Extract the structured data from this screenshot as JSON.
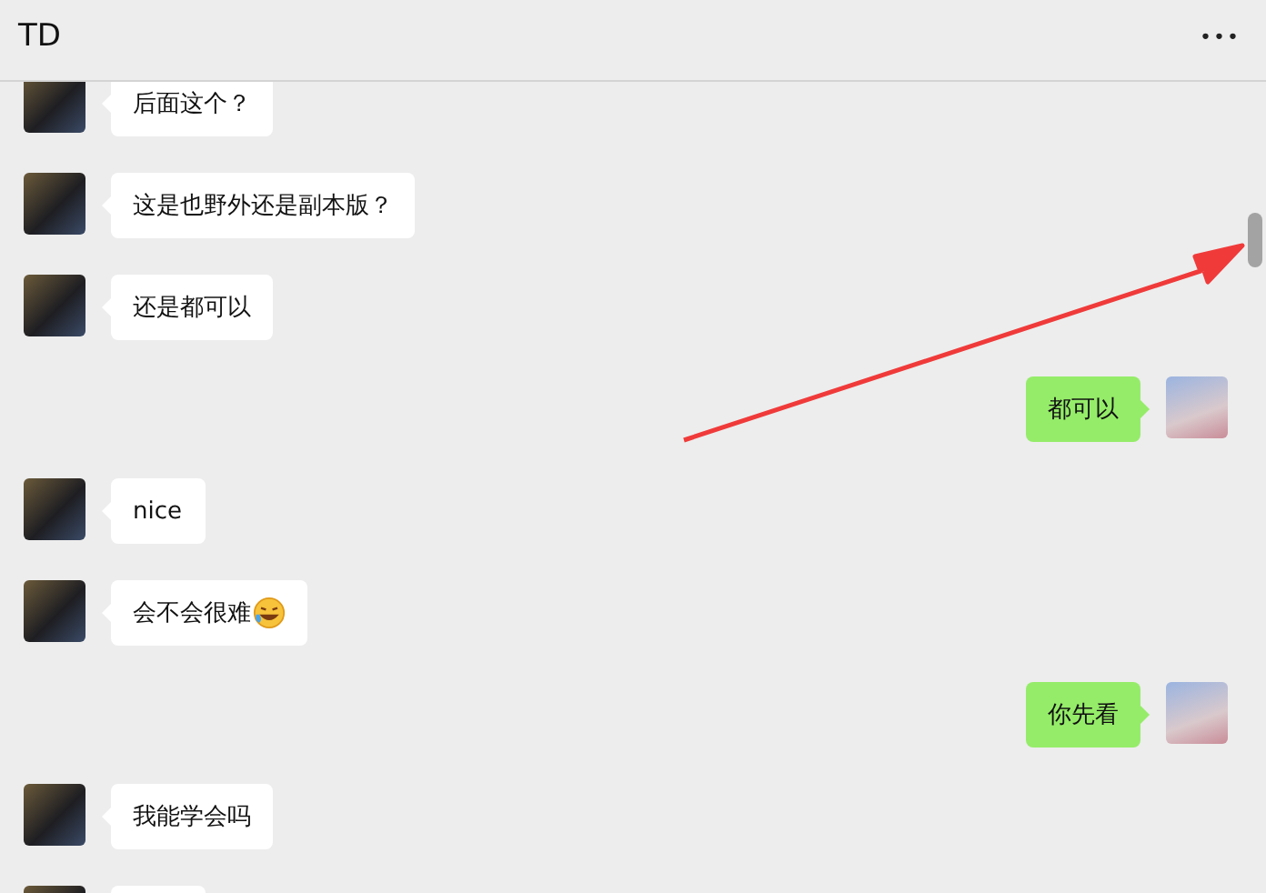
{
  "header": {
    "title": "TD",
    "menu": "•••"
  },
  "messages": [
    {
      "kind": "left",
      "text": "后面这个？"
    },
    {
      "kind": "left",
      "text": "这是也野外还是副本版？"
    },
    {
      "kind": "left",
      "text": "还是都可以"
    },
    {
      "kind": "right",
      "text": "都可以"
    },
    {
      "kind": "left",
      "text": "nice"
    },
    {
      "kind": "left",
      "text": "会不会很难",
      "emoji": true
    },
    {
      "kind": "right",
      "text": "你先看"
    },
    {
      "kind": "left",
      "text": "我能学会吗"
    },
    {
      "kind": "left"
    }
  ]
}
